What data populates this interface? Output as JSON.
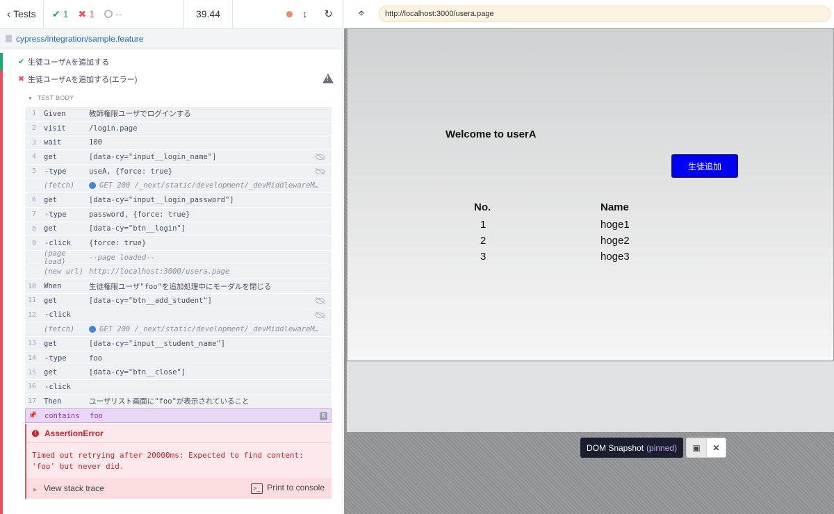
{
  "reporter": {
    "tests_label": "Tests",
    "passed": "1",
    "failed": "1",
    "pending": "--",
    "duration": "39.44",
    "spec_path": "cypress/integration/sample.feature",
    "test1": "生徒ユーザAを追加する",
    "test2": "生徒ユーザAを追加する(エラー)",
    "body_label": "TEST BODY",
    "commands": [
      {
        "num": "1",
        "name": "Given",
        "msg": "教師権限ユーザでログインする"
      },
      {
        "num": "2",
        "name": "visit",
        "msg": "/login.page"
      },
      {
        "num": "3",
        "name": "wait",
        "msg": "100"
      },
      {
        "num": "4",
        "name": "get",
        "msg": "[data-cy=\"input__login_name\"]"
      },
      {
        "num": "5",
        "name": "-type",
        "msg": "useA, {force: true}"
      },
      {
        "num": "",
        "name": "(fetch)",
        "msg": "GET 200 /_next/static/development/_devMiddlewareM…"
      },
      {
        "num": "6",
        "name": "get",
        "msg": "[data-cy=\"input__login_password\"]"
      },
      {
        "num": "7",
        "name": "-type",
        "msg": "password, {force: true}"
      },
      {
        "num": "8",
        "name": "get",
        "msg": "[data-cy=\"btn__login\"]"
      },
      {
        "num": "9",
        "name": "-click",
        "msg": "{force: true}"
      },
      {
        "num": "",
        "name": "(page load)",
        "msg": "--page loaded--"
      },
      {
        "num": "",
        "name": "(new url)",
        "msg": "http://localhost:3000/usera.page"
      },
      {
        "num": "10",
        "name": "When",
        "msg": "生徒権限ユーザ\"foo\"を追加処理中にモーダルを閉じる"
      },
      {
        "num": "11",
        "name": "get",
        "msg": "[data-cy=\"btn__add_student\"]"
      },
      {
        "num": "12",
        "name": "-click",
        "msg": ""
      },
      {
        "num": "",
        "name": "(fetch)",
        "msg": "GET 200 /_next/static/development/_devMiddlewareM…"
      },
      {
        "num": "13",
        "name": "get",
        "msg": "[data-cy=\"input__student_name\"]"
      },
      {
        "num": "14",
        "name": "-type",
        "msg": "foo"
      },
      {
        "num": "15",
        "name": "get",
        "msg": "[data-cy=\"btn__close\"]"
      },
      {
        "num": "16",
        "name": "-click",
        "msg": ""
      },
      {
        "num": "17",
        "name": "Then",
        "msg": "ユーザリスト画面に\"foo\"が表示されていること"
      },
      {
        "num": "",
        "name": "contains",
        "msg": "foo",
        "badge": "0"
      }
    ],
    "error": {
      "title": "AssertionError",
      "message": "Timed out retrying after 20000ms: Expected to find content: 'foo' but never did.",
      "stack_label": "View stack trace",
      "print_label": "Print to console"
    }
  },
  "aut": {
    "url": "http://localhost:3000/usera.page",
    "welcome": "Welcome to userA",
    "add_button": "生徒追加",
    "table": {
      "headers": [
        "No.",
        "Name"
      ],
      "rows": [
        [
          "1",
          "hoge1"
        ],
        [
          "2",
          "hoge2"
        ],
        [
          "3",
          "hoge3"
        ]
      ]
    },
    "snapshot_label": "DOM Snapshot",
    "snapshot_pinned": "(pinned)"
  },
  "colors": {
    "pass": "#1fa971",
    "fail": "#e94f5f",
    "link": "#1f6fd1",
    "add_button_bg": "#0000f5",
    "pinned": "#8a2fc2"
  }
}
